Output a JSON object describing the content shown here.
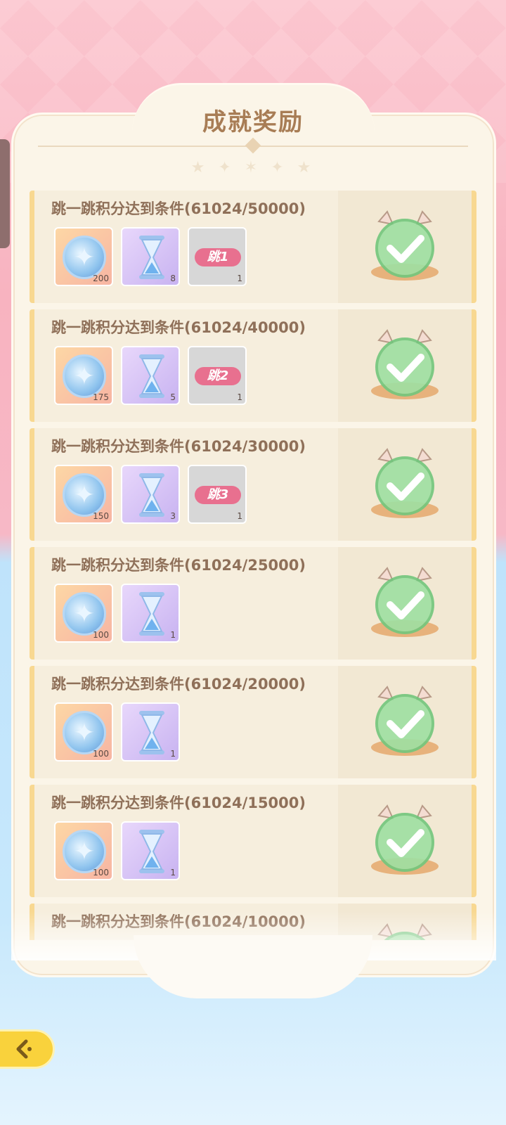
{
  "header": {
    "title": "成就奖励"
  },
  "achievements": [
    {
      "title": "跳一跳积分达到条件(61024/50000)",
      "rewards": [
        {
          "type": "crystal",
          "icon": "crystal-ball-icon",
          "count": "200"
        },
        {
          "type": "glass",
          "icon": "hourglass-icon",
          "count": "8"
        },
        {
          "type": "tag",
          "icon": "tag-icon",
          "label": "跳1",
          "count": "1"
        }
      ]
    },
    {
      "title": "跳一跳积分达到条件(61024/40000)",
      "rewards": [
        {
          "type": "crystal",
          "icon": "crystal-ball-icon",
          "count": "175"
        },
        {
          "type": "glass",
          "icon": "hourglass-icon",
          "count": "5"
        },
        {
          "type": "tag",
          "icon": "tag-icon",
          "label": "跳2",
          "count": "1"
        }
      ]
    },
    {
      "title": "跳一跳积分达到条件(61024/30000)",
      "rewards": [
        {
          "type": "crystal",
          "icon": "crystal-ball-icon",
          "count": "150"
        },
        {
          "type": "glass",
          "icon": "hourglass-icon",
          "count": "3"
        },
        {
          "type": "tag",
          "icon": "tag-icon",
          "label": "跳3",
          "count": "1"
        }
      ]
    },
    {
      "title": "跳一跳积分达到条件(61024/25000)",
      "rewards": [
        {
          "type": "crystal",
          "icon": "crystal-ball-icon",
          "count": "100"
        },
        {
          "type": "glass",
          "icon": "hourglass-icon",
          "count": "1"
        }
      ]
    },
    {
      "title": "跳一跳积分达到条件(61024/20000)",
      "rewards": [
        {
          "type": "crystal",
          "icon": "crystal-ball-icon",
          "count": "100"
        },
        {
          "type": "glass",
          "icon": "hourglass-icon",
          "count": "1"
        }
      ]
    },
    {
      "title": "跳一跳积分达到条件(61024/15000)",
      "rewards": [
        {
          "type": "crystal",
          "icon": "crystal-ball-icon",
          "count": "100"
        },
        {
          "type": "glass",
          "icon": "hourglass-icon",
          "count": "1"
        }
      ]
    },
    {
      "title": "跳一跳积分达到条件(61024/10000)",
      "rewards": []
    }
  ],
  "status_icon": "claimed-check-icon",
  "back_button_icon": "back-arrow-icon"
}
